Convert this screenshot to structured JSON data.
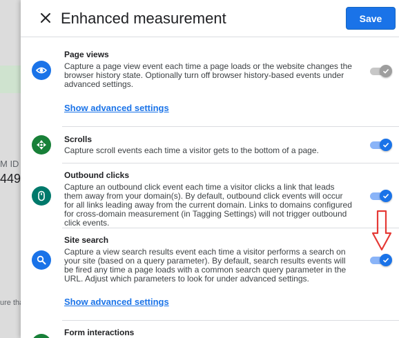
{
  "background": {
    "mid_text": "M ID",
    "big_text": "449",
    "low_text": "ure tha"
  },
  "header": {
    "close_icon": "close-icon",
    "title": "Enhanced measurement",
    "save_label": "Save"
  },
  "sections": [
    {
      "icon": "eye-icon",
      "title": "Page views",
      "description": "Capture a page view event each time a page loads or the website changes the browser history state. Optionally turn off browser history-based events under advanced settings.",
      "link": "Show advanced settings",
      "toggle_state": "on (disabled)"
    },
    {
      "icon": "scroll-arrows-icon",
      "title": "Scrolls",
      "description": "Capture scroll events each time a visitor gets to the bottom of a page.",
      "toggle_state": "on"
    },
    {
      "icon": "mouse-icon",
      "title": "Outbound clicks",
      "description": "Capture an outbound click event each time a visitor clicks a link that leads them away from your domain(s). By default, outbound click events will occur for all links leading away from the current domain. Links to domains configured for cross-domain measurement (in Tagging Settings) will not trigger outbound click events.",
      "toggle_state": "on"
    },
    {
      "icon": "search-icon",
      "title": "Site search",
      "description": "Capture a view search results event each time a visitor performs a search on your site (based on a query parameter). By default, search results events will be fired any time a page loads with a common search query parameter in the URL. Adjust which parameters to look for under advanced settings.",
      "link": "Show advanced settings",
      "toggle_state": "on"
    },
    {
      "icon": "form-icon",
      "title": "Form interactions"
    }
  ],
  "colors": {
    "accent": "#1a73e8",
    "annotation_arrow": "#e53935",
    "scroll_icon_bg": "#188038",
    "outbound_icon_bg": "#00796b"
  }
}
